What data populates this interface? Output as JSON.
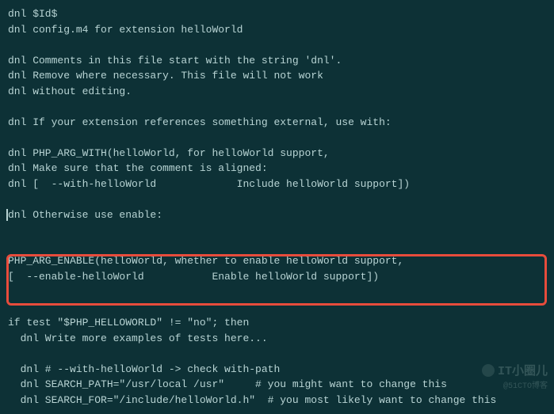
{
  "lines": [
    "dnl $Id$",
    "dnl config.m4 for extension helloWorld",
    "",
    "dnl Comments in this file start with the string 'dnl'.",
    "dnl Remove where necessary. This file will not work",
    "dnl without editing.",
    "",
    "dnl If your extension references something external, use with:",
    "",
    "dnl PHP_ARG_WITH(helloWorld, for helloWorld support,",
    "dnl Make sure that the comment is aligned:",
    "dnl [  --with-helloWorld             Include helloWorld support])",
    "",
    "dnl Otherwise use enable:",
    "",
    "",
    "PHP_ARG_ENABLE(helloWorld, whether to enable helloWorld support,",
    "[  --enable-helloWorld           Enable helloWorld support])",
    "",
    "",
    "if test \"$PHP_HELLOWORLD\" != \"no\"; then",
    "  dnl Write more examples of tests here...",
    "",
    "  dnl # --with-helloWorld -> check with-path",
    "  dnl SEARCH_PATH=\"/usr/local /usr\"     # you might want to change this",
    "  dnl SEARCH_FOR=\"/include/helloWorld.h\"  # you most likely want to change this"
  ],
  "cursor_line": 13,
  "watermark": {
    "main": "IT小圈儿",
    "sub": "@51CTO博客"
  }
}
